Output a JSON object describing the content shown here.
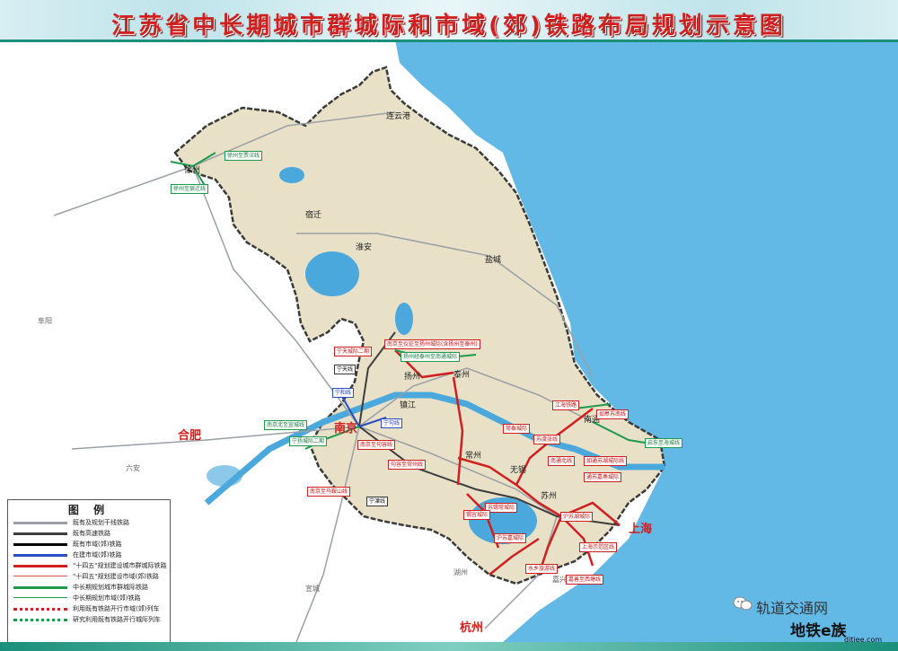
{
  "title": "江苏省中长期城市群城际和市域(郊)铁路布局规划示意图",
  "legend": {
    "title": "图 例",
    "items": [
      {
        "label": "既有及规划干线铁路",
        "color": "#9aa0a6",
        "style": "solid"
      },
      {
        "label": "既有高速铁路",
        "color": "#3d3d3d",
        "style": "solid"
      },
      {
        "label": "既有市域(郊)铁路",
        "color": "#000000",
        "style": "solid"
      },
      {
        "label": "在建市域(郊)铁路",
        "color": "#2a4ec0",
        "style": "solid"
      },
      {
        "label": "\"十四五\"规划建设城市群城际铁路",
        "color": "#d01f1f",
        "style": "solid"
      },
      {
        "label": "\"十四五\"规划建设市域(郊)铁路",
        "color": "#e05050",
        "style": "thin"
      },
      {
        "label": "中长期规划城市群城际铁路",
        "color": "#1d9a4a",
        "style": "solid"
      },
      {
        "label": "中长期规划市域(郊)铁路",
        "color": "#1d9a4a",
        "style": "thin"
      },
      {
        "label": "利用既有铁路开行市域(郊)列车",
        "color": "#d01f1f",
        "style": "dotted"
      },
      {
        "label": "研究利用既有铁路开行城际列车",
        "color": "#1d9a4a",
        "style": "dotted"
      }
    ]
  },
  "cities_major": [
    {
      "name": "南京"
    },
    {
      "name": "合肥"
    },
    {
      "name": "上海"
    },
    {
      "name": "杭州"
    }
  ],
  "cities": [
    {
      "name": "徐州"
    },
    {
      "name": "连云港"
    },
    {
      "name": "宿迁"
    },
    {
      "name": "淮安"
    },
    {
      "name": "盐城"
    },
    {
      "name": "扬州"
    },
    {
      "name": "泰州"
    },
    {
      "name": "镇江"
    },
    {
      "name": "南通"
    },
    {
      "name": "常州"
    },
    {
      "name": "无锡"
    },
    {
      "name": "苏州"
    }
  ],
  "cities_outside": [
    {
      "name": "阜阳"
    },
    {
      "name": "六安"
    },
    {
      "name": "湖州"
    },
    {
      "name": "嘉兴"
    },
    {
      "name": "宣城"
    }
  ],
  "line_labels": [
    {
      "text": "宁天线",
      "kind": "black"
    },
    {
      "text": "宁天城际二期",
      "kind": "red"
    },
    {
      "text": "宁和线",
      "kind": "blue"
    },
    {
      "text": "宁句线",
      "kind": "blue"
    },
    {
      "text": "宁溧线",
      "kind": "black"
    },
    {
      "text": "宁扬城际二期",
      "kind": "green"
    },
    {
      "text": "南京至马鞍山线",
      "kind": "red"
    },
    {
      "text": "南京北至宣城线",
      "kind": "green"
    },
    {
      "text": "南京至句容线",
      "kind": "red"
    },
    {
      "text": "南京至仪征至扬州城际(含扬州至泰州)",
      "kind": "red"
    },
    {
      "text": "扬州经泰州至南通城际",
      "kind": "green"
    },
    {
      "text": "句容至常州线",
      "kind": "red"
    },
    {
      "text": "常泰城际",
      "kind": "red"
    },
    {
      "text": "苏锡常城际",
      "kind": "red"
    },
    {
      "text": "锡宜城际",
      "kind": "red"
    },
    {
      "text": "沪苏嘉城际",
      "kind": "red"
    },
    {
      "text": "水乡旅游线",
      "kind": "red"
    },
    {
      "text": "江海铁路",
      "kind": "red"
    },
    {
      "text": "苏虞张线",
      "kind": "red"
    },
    {
      "text": "如皋苏南线",
      "kind": "red"
    },
    {
      "text": "如通苏湖城际线",
      "kind": "red"
    },
    {
      "text": "通苏嘉甬城际",
      "kind": "red"
    },
    {
      "text": "沪苏湖城际",
      "kind": "red"
    },
    {
      "text": "上海示范区线",
      "kind": "red"
    },
    {
      "text": "嘉善至西塘线",
      "kind": "red"
    },
    {
      "text": "启东至海城线",
      "kind": "green"
    },
    {
      "text": "南通北线",
      "kind": "red"
    },
    {
      "text": "徐州至贾汪线",
      "kind": "green"
    },
    {
      "text": "徐州至宿迁线",
      "kind": "green"
    }
  ],
  "watermark": {
    "brand": "轨道交通网",
    "site_name": "地铁e族",
    "site_url": "ditiee.com"
  },
  "colors": {
    "sea": "#62b9e6",
    "province_fill": "#e8e1c8",
    "neighbor_fill": "#ffffff",
    "water": "#4aa8dc",
    "red_line": "#d01f1f",
    "green_line": "#1d9a4a",
    "blue_line": "#2a4ec0"
  }
}
